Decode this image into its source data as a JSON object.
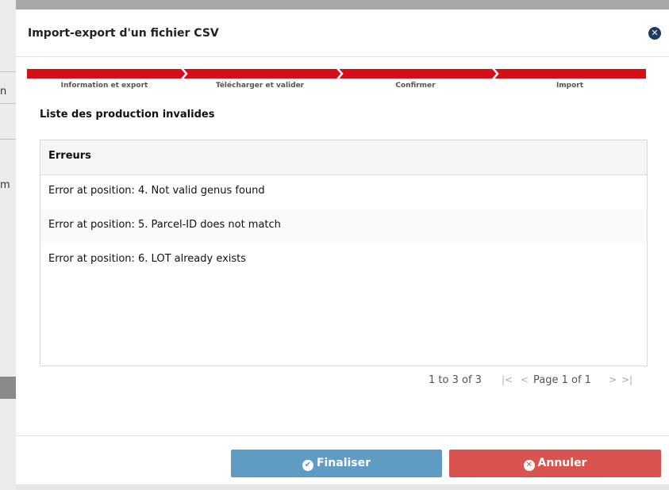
{
  "backdrop": {
    "chars": [
      "n",
      "m"
    ]
  },
  "modal": {
    "title": "Import-export d'un fichier CSV",
    "close_icon": "✕"
  },
  "stepper": {
    "steps": [
      {
        "label": "Information et export"
      },
      {
        "label": "Télécharger et valider"
      },
      {
        "label": "Confirmer"
      },
      {
        "label": "Import"
      }
    ],
    "color": "#d50e18"
  },
  "section": {
    "title": "Liste des production invalides"
  },
  "grid": {
    "header": "Erreurs",
    "rows": [
      "Error at position: 4. Not valid genus found",
      "Error at position: 5. Parcel-ID does not match",
      "Error at position: 6. LOT already exists"
    ]
  },
  "pager": {
    "summary": "1 to 3 of 3",
    "first": "|<",
    "prev": "<",
    "page_text": "Page 1 of 1",
    "next": ">",
    "last": ">|"
  },
  "footer": {
    "finish_label": "Finaliser",
    "finish_icon": "✔",
    "cancel_label": "Annuler",
    "cancel_icon": "✕",
    "finish_color": "#5f9cc4",
    "cancel_color": "#d9534f"
  }
}
